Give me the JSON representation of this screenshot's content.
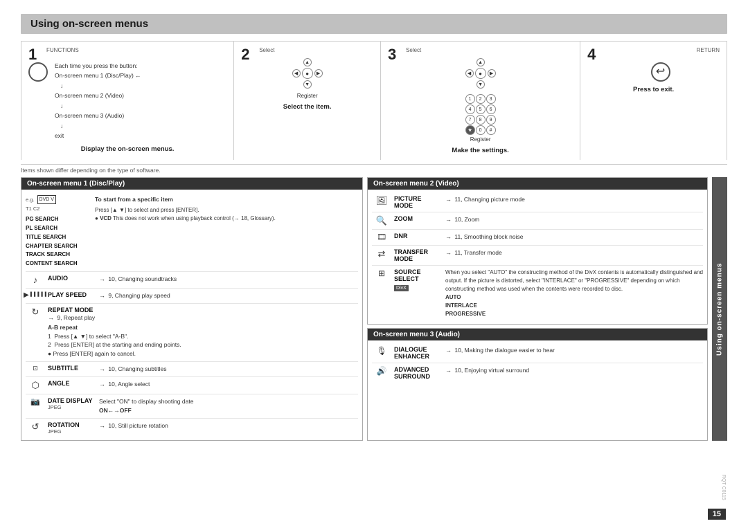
{
  "title": "Using on-screen menus",
  "steps": [
    {
      "number": "1",
      "top_label": "FUNCTIONS",
      "menu_items_text": [
        "On-screen menu 1 (Disc/Play)",
        "On-screen menu 2 (Video)",
        "On-screen menu 3 (Audio)",
        "exit"
      ],
      "each_time_text": "Each time you press the button:",
      "description": "Display the on-screen menus."
    },
    {
      "number": "2",
      "top_label": "Select",
      "register_label": "Register",
      "description": "Select the item."
    },
    {
      "number": "3",
      "top_label": "Select",
      "register_label": "Register",
      "description": "Make the settings."
    },
    {
      "number": "4",
      "top_label": "RETURN",
      "description": "Press to exit."
    }
  ],
  "bottom_note": "Items shown differ depending on the type of software.",
  "section_disc": {
    "header": "On-screen menu 1 (Disc/Play)",
    "top_items": [
      "PG SEARCH",
      "PL SEARCH",
      "TITLE SEARCH",
      "CHAPTER SEARCH",
      "TRACK SEARCH",
      "CONTENT SEARCH"
    ],
    "top_right_title": "To start from a specific item",
    "top_right_desc": "Press [▲ ▼] to select and press [ENTER].\n● VCD  This does not work when using playback control (→ 18, Glossary).",
    "items": [
      {
        "icon": "♪",
        "label": "AUDIO",
        "desc": "→ 10, Changing soundtracks"
      },
      {
        "icon": "▶",
        "label": "PLAY SPEED",
        "desc": "→ 9, Changing play speed"
      },
      {
        "icon": "↻",
        "label": "REPEAT MODE",
        "desc": "→ 9, Repeat play\nA-B repeat\n1  Press [▲ ▼] to select \"A-B\".\n2  Press [ENTER] at the starting and ending points.\n● Press [ENTER] again to cancel."
      },
      {
        "icon": "⊡",
        "label": "SUBTITLE",
        "desc": "→ 10, Changing subtitles"
      },
      {
        "icon": "🔄",
        "label": "ANGLE",
        "desc": "→ 10, Angle select"
      },
      {
        "icon": "📅",
        "label": "DATE DISPLAY",
        "sub_label": "JPEG",
        "desc": "Select \"ON\" to display shooting date\nON←→OFF"
      },
      {
        "icon": "↺",
        "label": "ROTATION",
        "sub_label": "JPEG",
        "desc": "→ 10, Still picture rotation"
      }
    ]
  },
  "section_video": {
    "header": "On-screen menu 2 (Video)",
    "items": [
      {
        "icon": "🖼",
        "label": "PICTURE MODE",
        "desc": "→ 11, Changing picture mode"
      },
      {
        "icon": "🔍",
        "label": "ZOOM",
        "desc": "→ 10, Zoom"
      },
      {
        "icon": "🎞",
        "label": "DNR",
        "desc": "→ 11, Smoothing block noise"
      },
      {
        "icon": "⇄",
        "label": "TRANSFER MODE",
        "desc": "→ 11, Transfer mode"
      },
      {
        "icon": "⊞",
        "label": "SOURCE SELECT",
        "sub_label": "DivX",
        "desc": "When you select \"AUTO\" the constructing method of the DivX contents is automatically distinguished and output. If the picture is distorted, select \"INTERLACE\" or \"PROGRESSIVE\" depending on which constructing method was used when the contents were recorded to disc.\nAUTO\nINTERLACE\nPROGRESSIVE"
      }
    ]
  },
  "section_audio": {
    "header": "On-screen menu 3 (Audio)",
    "items": [
      {
        "icon": "🎙",
        "label": "DIALOGUE ENHANCER",
        "desc": "→ 10, Making the dialogue easier to hear"
      },
      {
        "icon": "🔊",
        "label": "ADVANCED SURROUND",
        "desc": "→ 10, Enjoying virtual surround"
      }
    ]
  },
  "sidebar_label": "Using on-screen menus",
  "page_number": "15",
  "rqtc_code": "RQT C0115"
}
